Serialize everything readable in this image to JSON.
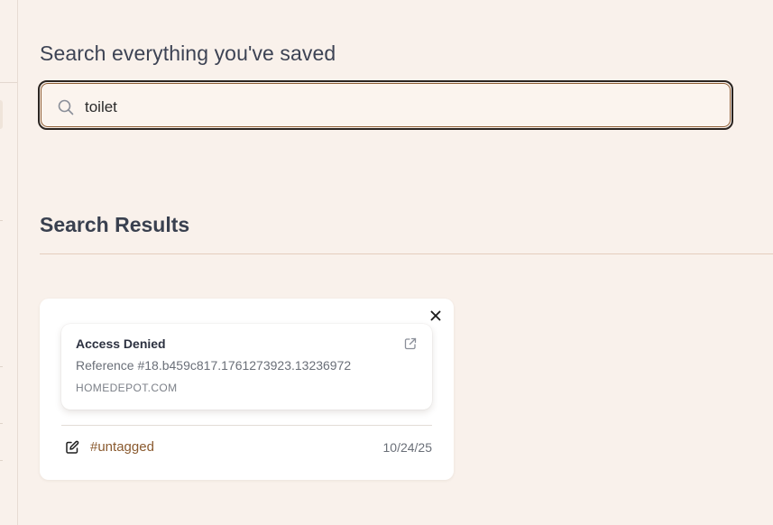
{
  "heading": "Search everything you've saved",
  "search": {
    "value": "toilet",
    "icon": "search-icon"
  },
  "results": {
    "title": "Search Results",
    "items": [
      {
        "title": "Access Denied",
        "description": "Reference #18.b459c817.1761273923.13236972",
        "domain": "HOMEDEPOT.COM",
        "tag": "#untagged",
        "date": "10/24/25"
      }
    ]
  },
  "colors": {
    "background": "#f9f1eb",
    "accent": "#8a5a2f",
    "focus_border": "#8d5d34"
  }
}
